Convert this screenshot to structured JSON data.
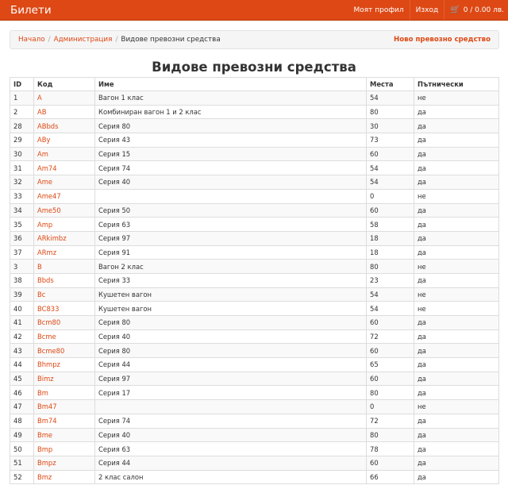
{
  "navbar": {
    "brand": "Билети",
    "profile": "Моят профил",
    "logout": "Изход",
    "cart": "0 / 0.00 лв.",
    "cart_icon": "cart-icon"
  },
  "breadcrumb": {
    "home": "Начало",
    "admin": "Администрация",
    "current": "Видове превозни средства",
    "new_link": "Ново превозно средство"
  },
  "page": {
    "title": "Видове превозни средства"
  },
  "table": {
    "headers": {
      "id": "ID",
      "code": "Код",
      "name": "Име",
      "seats": "Места",
      "passenger": "Пътнически"
    },
    "rows": [
      {
        "id": "1",
        "code": "A",
        "name": "Вагон 1 клас",
        "seats": "54",
        "passenger": "не"
      },
      {
        "id": "2",
        "code": "AB",
        "name": "Комбиниран вагон 1 и 2 клас",
        "seats": "80",
        "passenger": "да"
      },
      {
        "id": "28",
        "code": "ABbds",
        "name": "Серия 80",
        "seats": "30",
        "passenger": "да"
      },
      {
        "id": "29",
        "code": "ABy",
        "name": "Серия 43",
        "seats": "73",
        "passenger": "да"
      },
      {
        "id": "30",
        "code": "Am",
        "name": "Серия 15",
        "seats": "60",
        "passenger": "да"
      },
      {
        "id": "31",
        "code": "Am74",
        "name": "Серия 74",
        "seats": "54",
        "passenger": "да"
      },
      {
        "id": "32",
        "code": "Ame",
        "name": "Серия 40",
        "seats": "54",
        "passenger": "да"
      },
      {
        "id": "33",
        "code": "Ame47",
        "name": "",
        "seats": "0",
        "passenger": "не"
      },
      {
        "id": "34",
        "code": "Ame50",
        "name": "Серия 50",
        "seats": "60",
        "passenger": "да"
      },
      {
        "id": "35",
        "code": "Amp",
        "name": "Серия 63",
        "seats": "58",
        "passenger": "да"
      },
      {
        "id": "36",
        "code": "ARkimbz",
        "name": "Серия 97",
        "seats": "18",
        "passenger": "да"
      },
      {
        "id": "37",
        "code": "ARmz",
        "name": "Серия 91",
        "seats": "18",
        "passenger": "да"
      },
      {
        "id": "3",
        "code": "B",
        "name": "Вагон 2 клас",
        "seats": "80",
        "passenger": "не"
      },
      {
        "id": "38",
        "code": "Bbds",
        "name": "Серия 33",
        "seats": "23",
        "passenger": "да"
      },
      {
        "id": "39",
        "code": "Bc",
        "name": "Кушетен вагон",
        "seats": "54",
        "passenger": "не"
      },
      {
        "id": "40",
        "code": "BC833",
        "name": "Кушетен вагон",
        "seats": "54",
        "passenger": "не"
      },
      {
        "id": "41",
        "code": "Bcm80",
        "name": "Серия 80",
        "seats": "60",
        "passenger": "да"
      },
      {
        "id": "42",
        "code": "Bcme",
        "name": "Серия 40",
        "seats": "72",
        "passenger": "да"
      },
      {
        "id": "43",
        "code": "Bcme80",
        "name": "Серия 80",
        "seats": "60",
        "passenger": "да"
      },
      {
        "id": "44",
        "code": "Bhmpz",
        "name": "Серия 44",
        "seats": "65",
        "passenger": "да"
      },
      {
        "id": "45",
        "code": "Bimz",
        "name": "Серия 97",
        "seats": "60",
        "passenger": "да"
      },
      {
        "id": "46",
        "code": "Bm",
        "name": "Серия 17",
        "seats": "80",
        "passenger": "да"
      },
      {
        "id": "47",
        "code": "Bm47",
        "name": "",
        "seats": "0",
        "passenger": "не"
      },
      {
        "id": "48",
        "code": "Bm74",
        "name": "Серия 74",
        "seats": "72",
        "passenger": "да"
      },
      {
        "id": "49",
        "code": "Bme",
        "name": "Серия 40",
        "seats": "80",
        "passenger": "да"
      },
      {
        "id": "50",
        "code": "Bmp",
        "name": "Серия 63",
        "seats": "78",
        "passenger": "да"
      },
      {
        "id": "51",
        "code": "Bmpz",
        "name": "Серия 44",
        "seats": "60",
        "passenger": "да"
      },
      {
        "id": "52",
        "code": "Bmz",
        "name": "2 клас салон",
        "seats": "66",
        "passenger": "да"
      }
    ]
  },
  "colors": {
    "accent": "#dd4814",
    "stripe": "#f9f9f9",
    "border": "#dddddd"
  }
}
